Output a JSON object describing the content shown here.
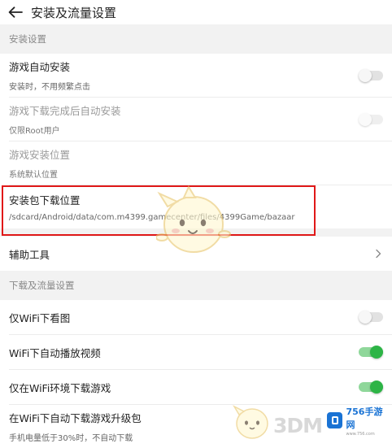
{
  "header": {
    "title": "安装及流量设置"
  },
  "install_section": {
    "title": "安装设置",
    "auto_install": {
      "label": "游戏自动安装",
      "desc": "安装时，不用频繁点击",
      "enabled": false
    },
    "auto_install_after_download": {
      "label": "游戏下载完成后自动安装",
      "desc": "仅限Root用户",
      "enabled": false
    },
    "install_location": {
      "label": "游戏安装位置",
      "desc": "系统默认位置"
    },
    "download_location": {
      "label": "安装包下载位置",
      "desc": "/sdcard/Android/data/com.m4399.gamecenter/files/4399Game/bazaar"
    }
  },
  "tools": {
    "label": "辅助工具"
  },
  "download_section": {
    "title": "下载及流量设置",
    "wifi_only_images": {
      "label": "仅WiFi下看图",
      "enabled": false
    },
    "wifi_autoplay_video": {
      "label": "WiFi下自动播放视频",
      "enabled": true
    },
    "wifi_only_download": {
      "label": "仅在WiFi环境下载游戏",
      "enabled": true
    },
    "wifi_auto_upgrade": {
      "label": "在WiFi下自动下载游戏升级包",
      "desc": "手机电量低于30%时，不自动下载"
    }
  },
  "watermarks": {
    "brand_3d": "3DM",
    "site_logo": "756手游网",
    "site_url": "www.756.com"
  },
  "colors": {
    "toggle_on": "#2db446",
    "highlight_box": "#e01818"
  }
}
